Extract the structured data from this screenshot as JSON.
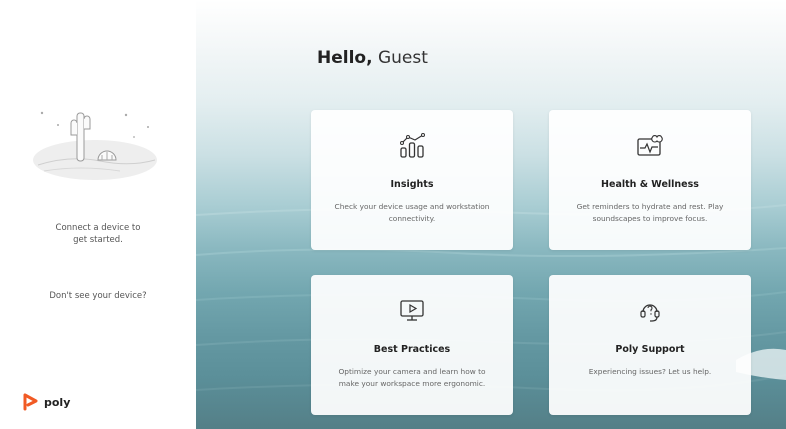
{
  "sidebar": {
    "connect_line1": "Connect a device to",
    "connect_line2": "get started.",
    "dont_see": "Don't see your device?",
    "logo_text": "poly",
    "logo_color": "#f15a24"
  },
  "greeting": {
    "hello": "Hello,",
    "name": "Guest"
  },
  "cards": [
    {
      "icon": "insights-chart-icon",
      "title": "Insights",
      "desc_line1": "Check your device usage and workstation",
      "desc_line2": "connectivity."
    },
    {
      "icon": "health-monitor-icon",
      "title": "Health & Wellness",
      "desc_line1": "Get reminders to hydrate and rest. Play",
      "desc_line2": "soundscapes to improve focus."
    },
    {
      "icon": "video-play-icon",
      "title": "Best Practices",
      "desc_line1": "Optimize your camera and learn how to",
      "desc_line2": "make your workspace more ergonomic."
    },
    {
      "icon": "support-headset-icon",
      "title": "Poly Support",
      "desc_line1": "Experiencing issues? Let us help.",
      "desc_line2": ""
    }
  ]
}
